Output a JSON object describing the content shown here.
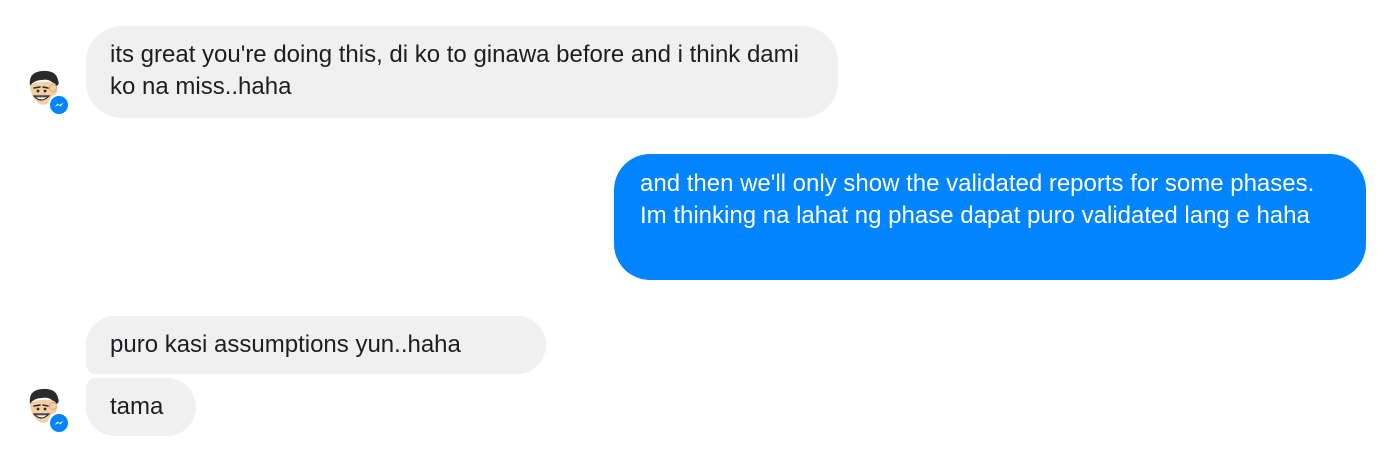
{
  "conversation": {
    "messages": [
      {
        "sender": "contact",
        "text": "its great you're doing this, di ko to ginawa before and i think dami ko na miss..haha"
      },
      {
        "sender": "me",
        "text": "and then we'll only show the validated reports for some phases. Im thinking na lahat ng phase dapat puro validated lang e haha"
      },
      {
        "sender": "contact",
        "text": "puro kasi assumptions yun..haha"
      },
      {
        "sender": "contact",
        "text": "tama"
      }
    ],
    "avatar_icon": "cartoon-face-avatar-icon",
    "badge_icon": "messenger-badge-icon",
    "colors": {
      "outgoing_bubble": "#0084ff",
      "incoming_bubble": "#f0f0f0",
      "outgoing_text": "#ffffff",
      "incoming_text": "#1c1e21"
    }
  }
}
